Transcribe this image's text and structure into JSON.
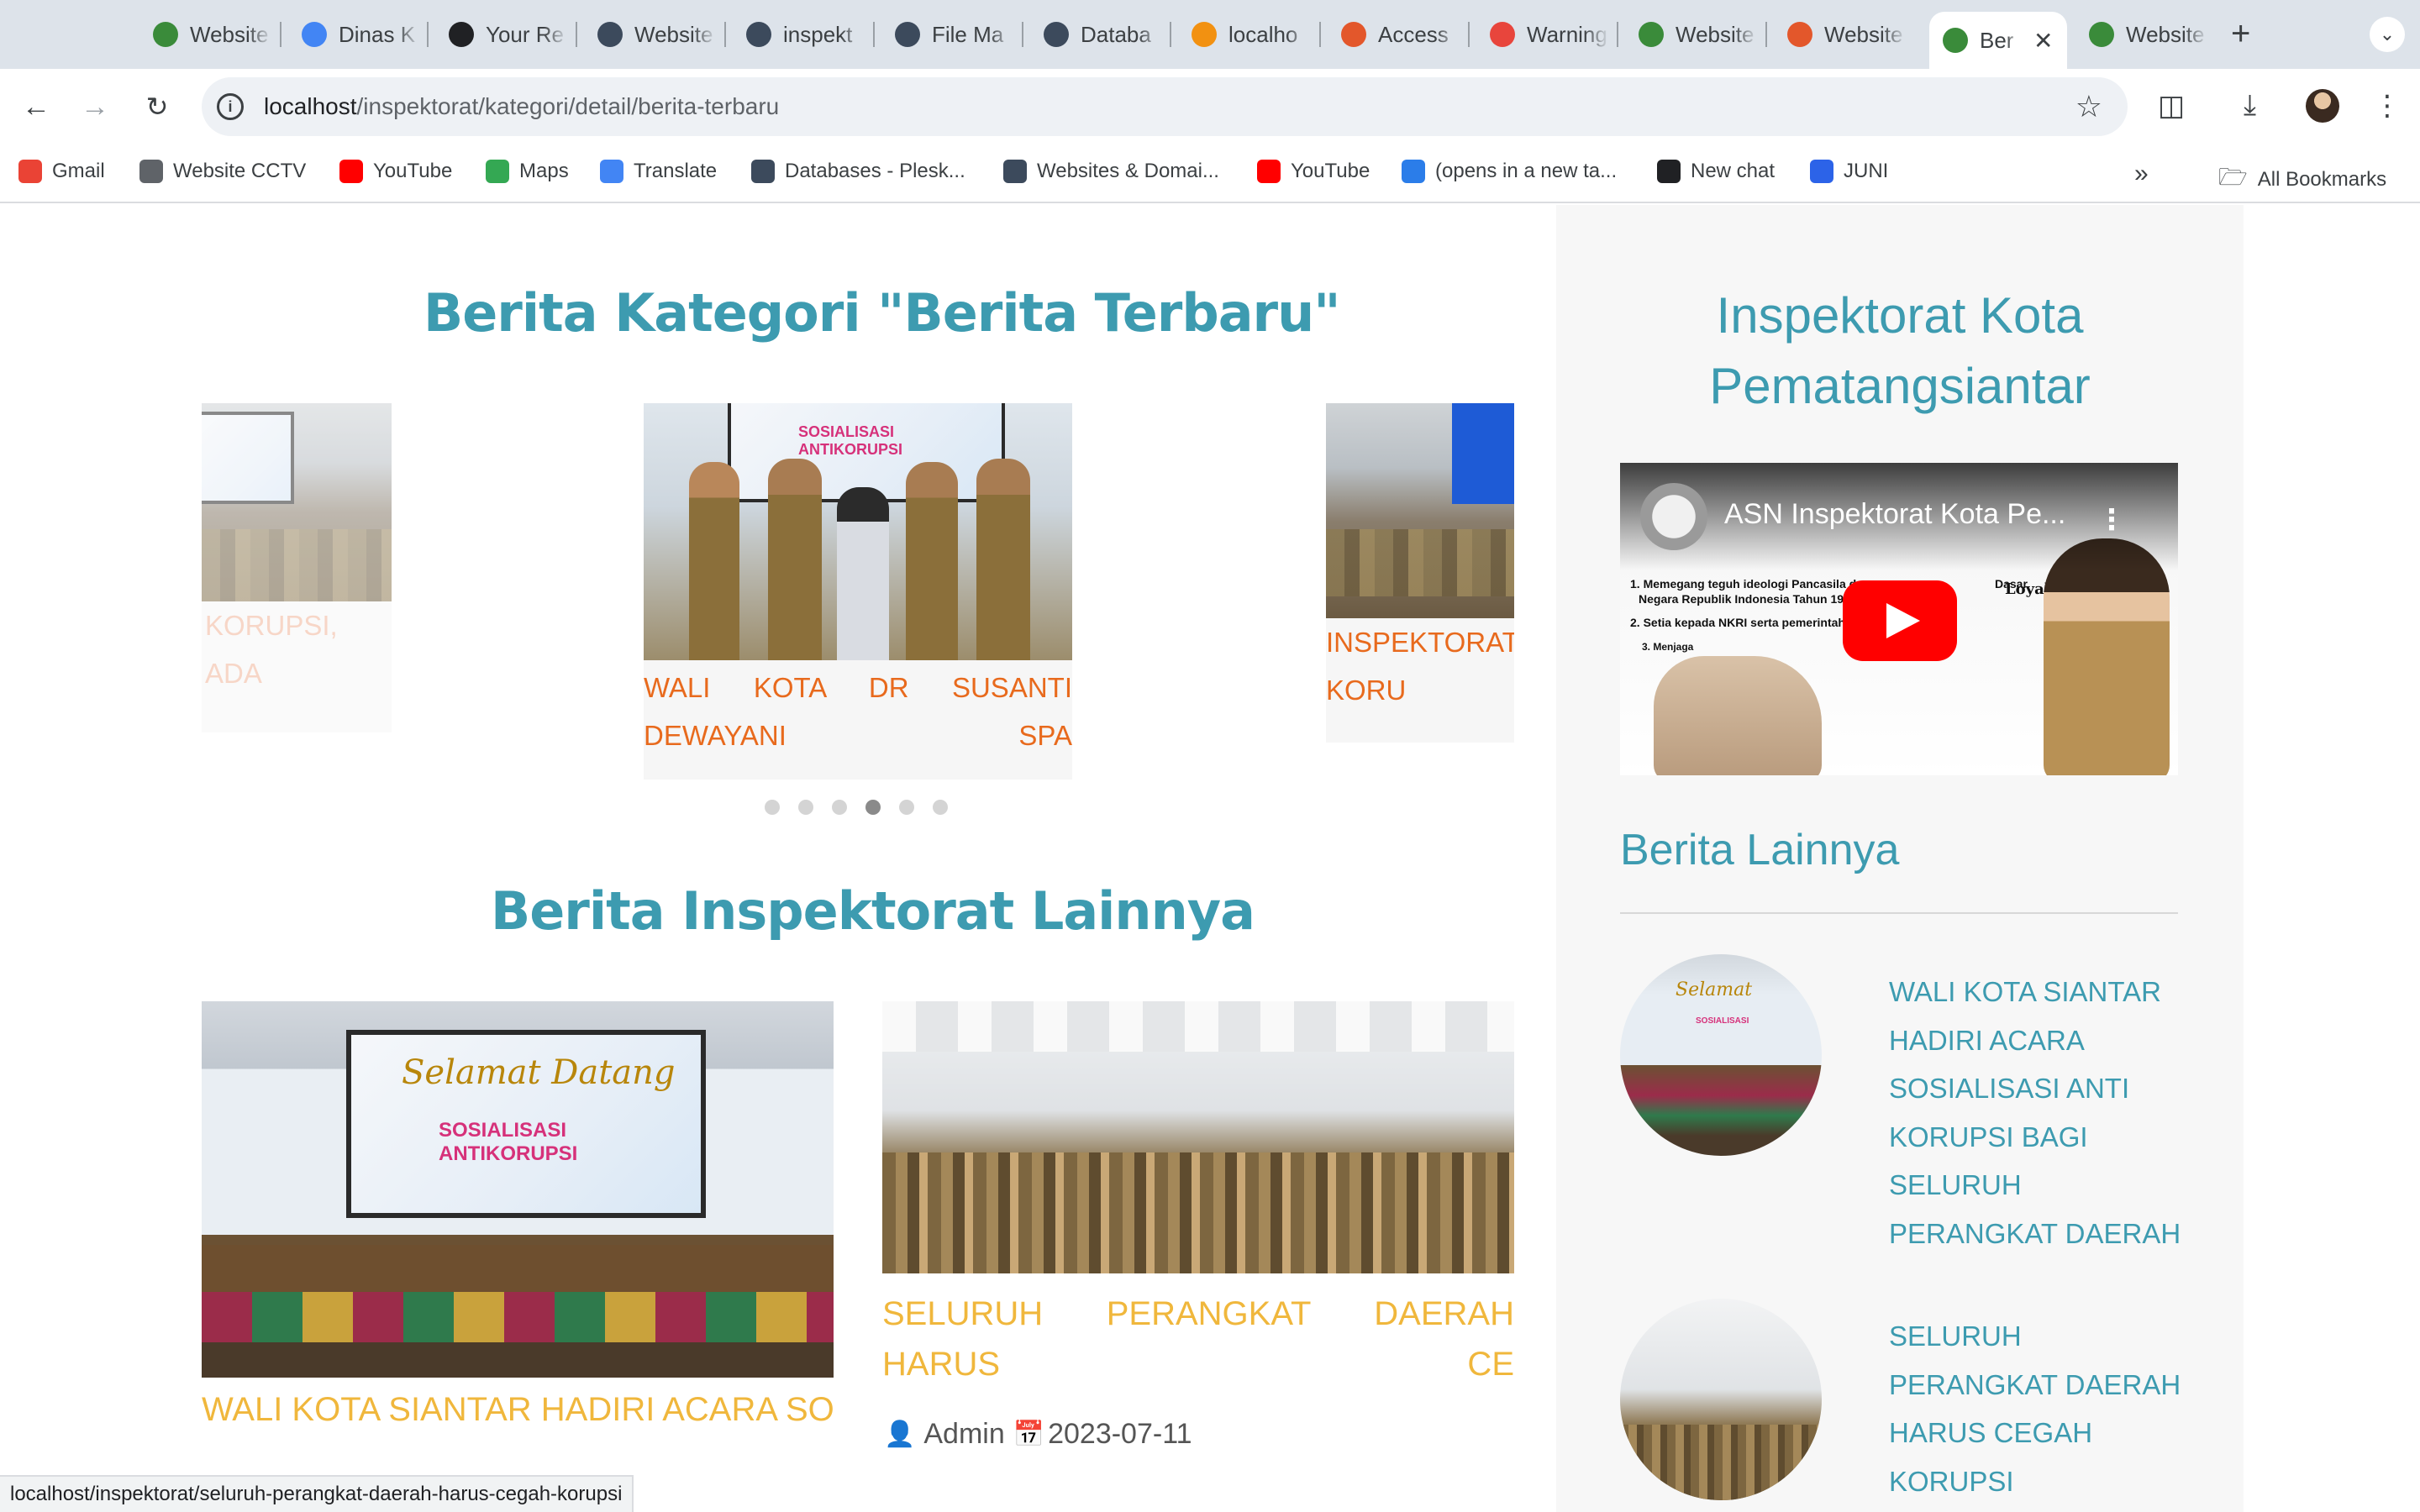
{
  "browser": {
    "tabs": [
      {
        "title": "Website",
        "fav": "website-favicon",
        "color": "#3a8b3a"
      },
      {
        "title": "Dinas K",
        "fav": "chrome-favicon",
        "color": "#4285f4"
      },
      {
        "title": "Your Re",
        "fav": "github-favicon",
        "color": "#202124"
      },
      {
        "title": "Website",
        "fav": "plesk-favicon",
        "color": "#3c4a5c"
      },
      {
        "title": "inspekt",
        "fav": "plesk-favicon",
        "color": "#3c4a5c"
      },
      {
        "title": "File Ma",
        "fav": "plesk-favicon",
        "color": "#3c4a5c"
      },
      {
        "title": "Databa",
        "fav": "plesk-favicon",
        "color": "#3c4a5c"
      },
      {
        "title": "localho",
        "fav": "phpmyadmin-favicon",
        "color": "#f29111"
      },
      {
        "title": "Access",
        "fav": "xampp-favicon",
        "color": "#e3572b"
      },
      {
        "title": "Warning",
        "fav": "warning-favicon",
        "color": "#e8453c"
      },
      {
        "title": "Website",
        "fav": "website-favicon",
        "color": "#3a8b3a"
      },
      {
        "title": "Website",
        "fav": "xampp-favicon",
        "color": "#e3572b"
      },
      {
        "title": "Ber",
        "fav": "website-favicon",
        "color": "#3a8b3a",
        "active": true
      },
      {
        "title": "Website",
        "fav": "website-favicon",
        "color": "#3a8b3a"
      }
    ],
    "url": {
      "host": "localhost",
      "path": "/inspektorat/kategori/detail/berita-terbaru"
    },
    "bookmarks": [
      {
        "label": "Gmail",
        "icon": "gmail-icon",
        "color": "#ea4335"
      },
      {
        "label": "Website CCTV",
        "icon": "globe-icon",
        "color": "#5f6368"
      },
      {
        "label": "YouTube",
        "icon": "youtube-icon",
        "color": "#ff0000"
      },
      {
        "label": "Maps",
        "icon": "maps-icon",
        "color": "#34a853"
      },
      {
        "label": "Translate",
        "icon": "translate-icon",
        "color": "#4285f4"
      },
      {
        "label": "Databases - Plesk...",
        "icon": "plesk-icon",
        "color": "#3c4a5c"
      },
      {
        "label": "Websites & Domai...",
        "icon": "plesk-icon",
        "color": "#3c4a5c"
      },
      {
        "label": "YouTube",
        "icon": "youtube-icon",
        "color": "#ff0000"
      },
      {
        "label": "(opens in a new ta...",
        "icon": "canva-icon",
        "color": "#2b7de9"
      },
      {
        "label": "New chat",
        "icon": "openai-icon",
        "color": "#202124"
      },
      {
        "label": "JUNI",
        "icon": "meta-icon",
        "color": "#2c63e8"
      }
    ],
    "all_bookmarks": "All Bookmarks",
    "status_url": "localhost/inspektorat/seluruh-perangkat-daerah-harus-cegah-korupsi"
  },
  "main": {
    "category_heading": "Berita Kategori \"Berita Terbaru\"",
    "carousel": {
      "left_title": "KORUPSI, ADA",
      "center_title": "WALI KOTA DR SUSANTI DEWAYANI SPA",
      "right_title": "INSPEKTORAT KORU",
      "dots": 6,
      "active_dot": 3
    },
    "other_heading": "Berita Inspektorat Lainnya",
    "news": [
      {
        "title": "WALI KOTA SIANTAR HADIRI ACARA SO"
      },
      {
        "title": "SELURUH PERANGKAT DAERAH HARUS CE",
        "author": "Admin",
        "date": "2023-07-11"
      }
    ]
  },
  "sidebar": {
    "title": "Inspektorat Kota Pematangsiantar",
    "video": {
      "title": "ASN Inspektorat Kota Pe...",
      "line1": "1. Memegang teguh ideologi Pancasila da",
      "line1b": "Dasar",
      "line2": "Negara Republik Indonesia Tahun 194",
      "line3": "2. Setia kepada NKRI serta pemerintah",
      "line4": "3. Menjaga",
      "badge": "Loyal"
    },
    "other_heading": "Berita Lainnya",
    "links": [
      {
        "title": "WALI KOTA SIANTAR HADIRI ACARA SOSIALISASI ANTI KORUPSI BAGI SELURUH PERANGKAT DAERAH"
      },
      {
        "title": "SELURUH PERANGKAT DAERAH HARUS CEGAH KORUPSI"
      }
    ]
  }
}
